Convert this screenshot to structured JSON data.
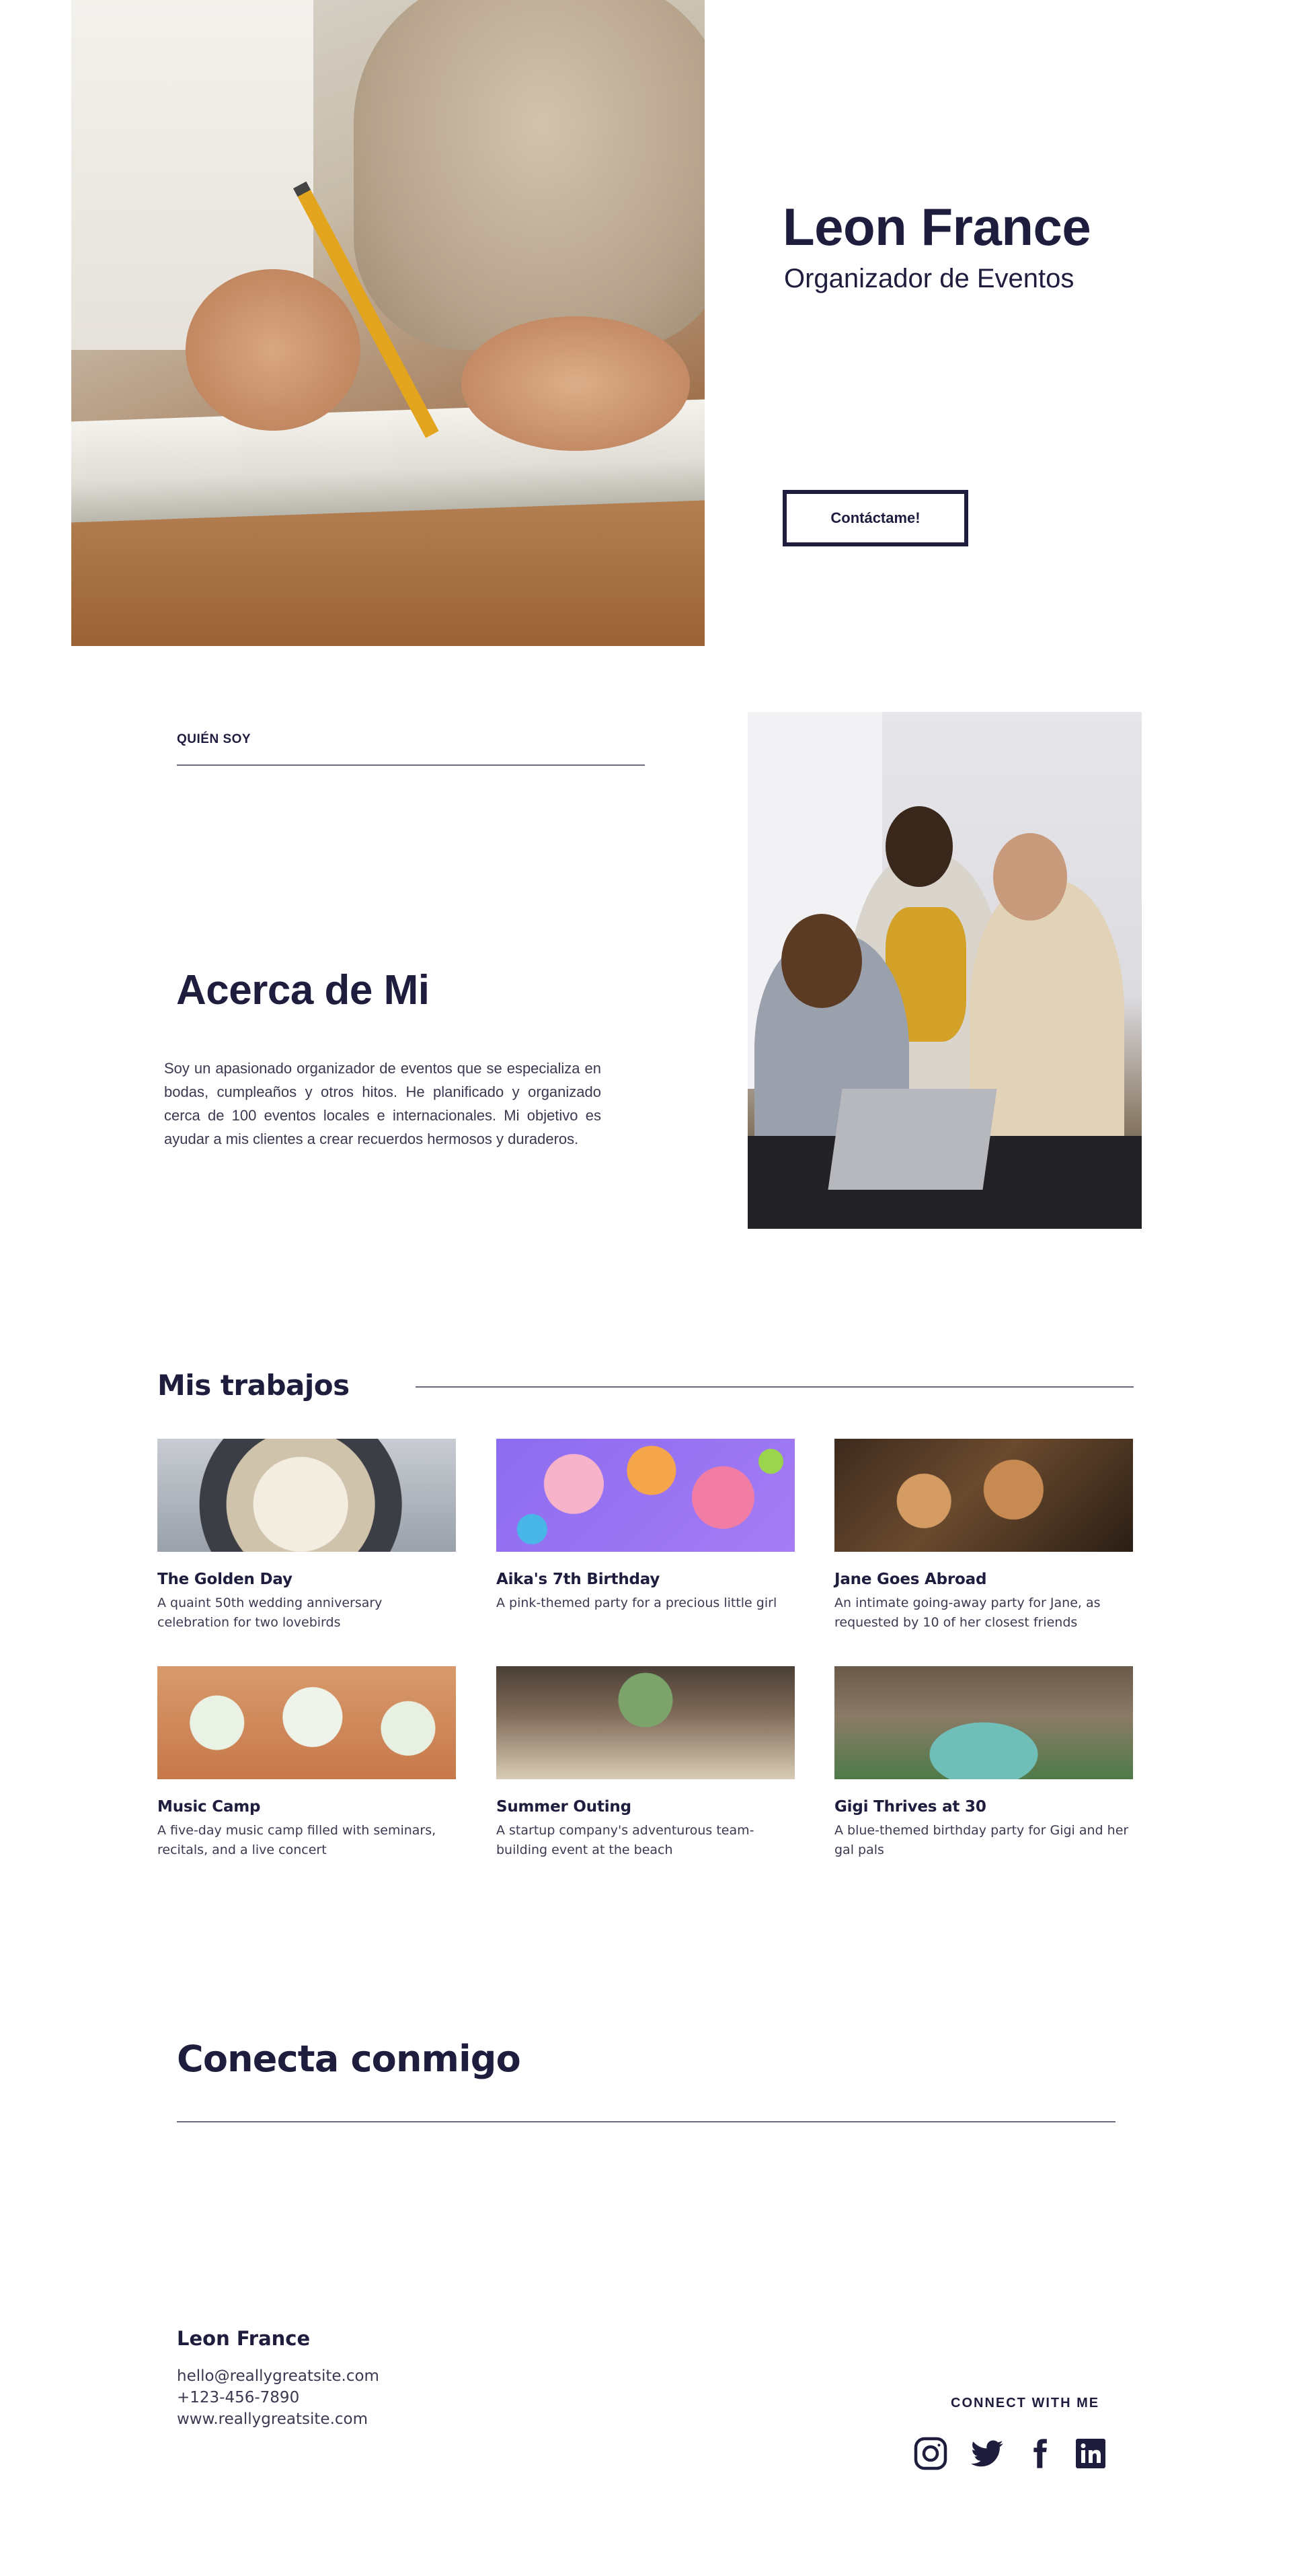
{
  "hero": {
    "name": "Leon France",
    "role": "Organizador de Eventos",
    "cta_label": "Contáctame!"
  },
  "about": {
    "kicker": "QUIÉN SOY",
    "title": "Acerca de Mi",
    "text": "Soy un apasionado organizador de eventos que se especializa en bodas, cumpleaños y otros hitos. He planificado y organizado cerca de 100 eventos locales e internacionales. Mi objetivo es ayudar a mis clientes a crear recuerdos hermosos y duraderos."
  },
  "works": {
    "title": "Mis trabajos",
    "items": [
      {
        "title": "The Golden Day",
        "desc": "A quaint 50th wedding anniversary celebration for two lovebirds"
      },
      {
        "title": "Aika's 7th Birthday",
        "desc": "A pink-themed party for a precious little girl"
      },
      {
        "title": "Jane Goes Abroad",
        "desc": "An intimate going-away party for Jane, as requested by 10 of her closest friends"
      },
      {
        "title": "Music Camp",
        "desc": "A five-day music camp filled with seminars, recitals, and a live concert"
      },
      {
        "title": "Summer Outing",
        "desc": "A startup company's adventurous team-building event at the beach"
      },
      {
        "title": "Gigi Thrives at 30",
        "desc": "A blue-themed birthday party for Gigi and her gal pals"
      }
    ]
  },
  "connect": {
    "title": "Conecta conmigo"
  },
  "footer": {
    "name": "Leon France",
    "email": "hello@reallygreatsite.com",
    "phone": "+123-456-7890",
    "website": "www.reallygreatsite.com",
    "connect_label": "CONNECT WITH ME",
    "social_icons": [
      "instagram-icon",
      "twitter-icon",
      "facebook-icon",
      "linkedin-icon"
    ]
  },
  "colors": {
    "navy": "#1e1d3d",
    "divider": "#6b6a7c",
    "background": "#ffffff"
  }
}
